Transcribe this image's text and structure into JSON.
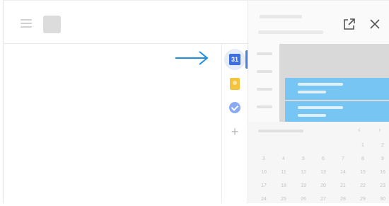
{
  "header": {
    "menu_icon": "menu-icon",
    "logo_icon": "app-logo"
  },
  "annotation": {
    "arrow_color": "#1e8fe0"
  },
  "side_rail": {
    "items": [
      {
        "name": "calendar",
        "icon": "calendar-icon",
        "label": "31",
        "color": "#3c6fe0",
        "active": true
      },
      {
        "name": "keep",
        "icon": "keep-icon",
        "color": "#f6c33d"
      },
      {
        "name": "tasks",
        "icon": "tasks-icon",
        "color": "#8aaaf2"
      },
      {
        "name": "add",
        "icon": "add-icon",
        "label": "+"
      }
    ]
  },
  "panel": {
    "open_icon": "open-in-new-icon",
    "close_icon": "close-icon",
    "event_color": "#77c5f2",
    "mini_calendar": {
      "rows": [
        [
          "",
          "",
          "",
          "",
          "",
          "1",
          "2"
        ],
        [
          "3",
          "4",
          "5",
          "6",
          "7",
          "8",
          "9"
        ],
        [
          "10",
          "11",
          "12",
          "13",
          "14",
          "15",
          "16"
        ],
        [
          "17",
          "18",
          "19",
          "20",
          "21",
          "22",
          "23"
        ],
        [
          "24",
          "25",
          "26",
          "27",
          "28",
          "29",
          "30"
        ]
      ]
    }
  }
}
